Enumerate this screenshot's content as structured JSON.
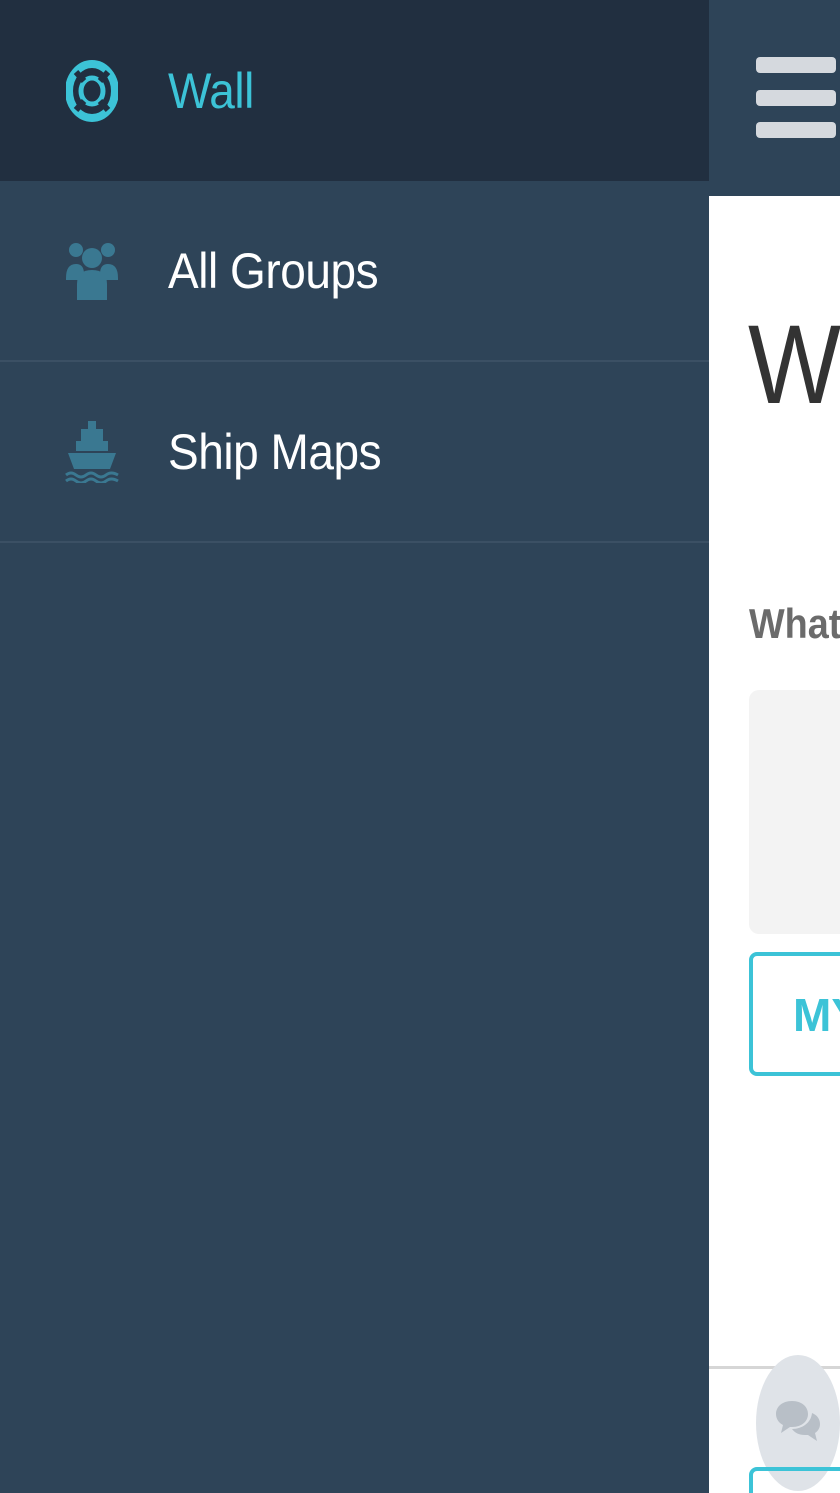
{
  "colors": {
    "sidebar_bg": "#2e4458",
    "active_item_bg": "#212f40",
    "accent": "#3cc3d7",
    "icon_inactive": "#3a7891"
  },
  "sidebar": {
    "items": [
      {
        "label": "Wall",
        "icon": "life-ring-icon",
        "active": true
      },
      {
        "label": "All Groups",
        "icon": "group-icon",
        "active": false
      },
      {
        "label": "Ship Maps",
        "icon": "ship-icon",
        "active": false
      }
    ]
  },
  "main": {
    "menu_icon": "hamburger-icon",
    "title": "Wa",
    "prompt": "What",
    "my_button_label": "MY",
    "chat_icon": "chat-bubbles-icon"
  }
}
